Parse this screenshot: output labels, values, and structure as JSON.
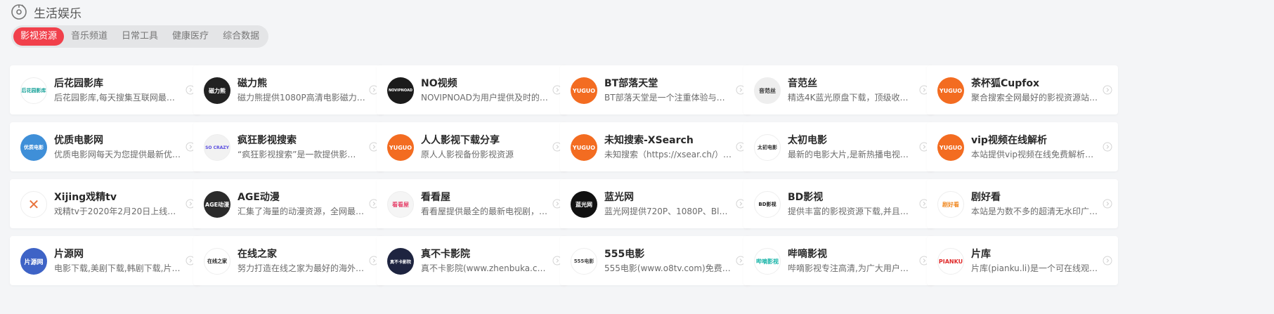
{
  "section": {
    "icon": "music-disc-icon",
    "title": "生活娱乐"
  },
  "tabs": [
    {
      "label": "影视资源",
      "active": true
    },
    {
      "label": "音乐频道",
      "active": false
    },
    {
      "label": "日常工具",
      "active": false
    },
    {
      "label": "健康医疗",
      "active": false
    },
    {
      "label": "综合数据",
      "active": false
    }
  ],
  "colors": {
    "accent": "#f1404b",
    "yuguo_orange": "#f36c21"
  },
  "cards": [
    {
      "title": "后花园影库",
      "desc": "后花园影库,每天搜集互联网最新…",
      "logo": {
        "text": "后花园影库",
        "bg": "#ffffff",
        "fg": "#1aa39a",
        "size": 7
      }
    },
    {
      "title": "磁力熊",
      "desc": "磁力熊提供1080P高清电影磁力…",
      "logo": {
        "text": "磁力熊",
        "bg": "#222222",
        "fg": "#ffffff",
        "size": 8
      }
    },
    {
      "title": "NO视频",
      "desc": "NOVIPNOAD为用户提供及时的…",
      "logo": {
        "text": "NOVIPNOAD",
        "bg": "#1b1b1b",
        "fg": "#ffffff",
        "size": 5
      }
    },
    {
      "title": "BT部落天堂",
      "desc": "BT部落天堂是一个注重体验与质…",
      "logo": {
        "text": "YUGUO",
        "bg": "#f36c21",
        "fg": "#ffffff",
        "size": 8
      }
    },
    {
      "title": "音范丝",
      "desc": "精选4K蓝光原盘下载，顶级收藏…",
      "logo": {
        "text": "音范丝",
        "bg": "#eeeeee",
        "fg": "#333333",
        "size": 8
      }
    },
    {
      "title": "茶杯狐Cupfox",
      "desc": "聚合搜索全网最好的影视资源站…",
      "logo": {
        "text": "YUGUO",
        "bg": "#f36c21",
        "fg": "#ffffff",
        "size": 8
      }
    },
    {
      "title": "优质电影网",
      "desc": "优质电影网每天为您提供最新优…",
      "logo": {
        "text": "优质电影",
        "bg": "#3f8fd8",
        "fg": "#ffffff",
        "size": 7
      }
    },
    {
      "title": "疯狂影视搜索",
      "desc": "“疯狂影视搜索”是一款提供影…",
      "logo": {
        "text": "SO CRAZY",
        "bg": "#f2f2f2",
        "fg": "#5a4de0",
        "size": 6
      }
    },
    {
      "title": "人人影视下载分享",
      "desc": "原人人影视备份影视资源",
      "logo": {
        "text": "YUGUO",
        "bg": "#f36c21",
        "fg": "#ffffff",
        "size": 8
      }
    },
    {
      "title": "未知搜索-XSearch",
      "desc": "未知搜索（https://xsear.ch/）聚…",
      "logo": {
        "text": "YUGUO",
        "bg": "#f36c21",
        "fg": "#ffffff",
        "size": 8
      }
    },
    {
      "title": "太初电影",
      "desc": "最新的电影大片,是新热播电视剧,…",
      "logo": {
        "text": "太初电影",
        "bg": "#ffffff",
        "fg": "#333333",
        "size": 7
      }
    },
    {
      "title": "vip视频在线解析",
      "desc": "本站提供vip视频在线免费解析，…",
      "logo": {
        "text": "YUGUO",
        "bg": "#f36c21",
        "fg": "#ffffff",
        "size": 8
      }
    },
    {
      "title": "Xijing戏精tv",
      "desc": "戏精tv于2020年2月20日上线，…",
      "logo": {
        "text": "✕",
        "bg": "#ffffff",
        "fg": "#e8733c",
        "size": 20
      }
    },
    {
      "title": "AGE动漫",
      "desc": "汇集了海量的动漫资源，全网最…",
      "logo": {
        "text": "AGE动漫",
        "bg": "#2b2b2b",
        "fg": "#ffffff",
        "size": 8
      }
    },
    {
      "title": "看看屋",
      "desc": "看看屋提供最全的最新电视剧，2…",
      "logo": {
        "text": "看看屋",
        "bg": "#f5f5f5",
        "fg": "#e6466e",
        "size": 8
      }
    },
    {
      "title": "蓝光网",
      "desc": "蓝光网提供720P、1080P、BluR…",
      "logo": {
        "text": "蓝光网",
        "bg": "#111111",
        "fg": "#ffffff",
        "size": 8
      }
    },
    {
      "title": "BD影视",
      "desc": "提供丰富的影视资源下载,并且可…",
      "logo": {
        "text": "BD影视",
        "bg": "#ffffff",
        "fg": "#222222",
        "size": 7
      }
    },
    {
      "title": "剧好看",
      "desc": "本站是为数不多的超清无水印广…",
      "logo": {
        "text": "剧好看",
        "bg": "#ffffff",
        "fg": "#f08a24",
        "size": 8
      }
    },
    {
      "title": "片源网",
      "desc": "电影下载,美剧下载,韩剧下载,片源…",
      "logo": {
        "text": "片源网",
        "bg": "#3e63c6",
        "fg": "#ffffff",
        "size": 9
      }
    },
    {
      "title": "在线之家",
      "desc": "努力打造在线之家为最好的海外…",
      "logo": {
        "text": "在线之家",
        "bg": "#ffffff",
        "fg": "#222222",
        "size": 7
      }
    },
    {
      "title": "真不卡影院",
      "desc": "真不卡影院(www.zhenbuka.com…",
      "logo": {
        "text": "真不卡影院",
        "bg": "#1e2440",
        "fg": "#ffffff",
        "size": 6
      }
    },
    {
      "title": "555电影",
      "desc": "555电影(www.o8tv.com)免费为…",
      "logo": {
        "text": "555电影",
        "bg": "#ffffff",
        "fg": "#444444",
        "size": 7
      }
    },
    {
      "title": "哔嘀影视",
      "desc": "哔嘀影视专注高清,为广大用户提…",
      "logo": {
        "text": "哔嘀影视",
        "bg": "#ffffff",
        "fg": "#19b4a8",
        "size": 8
      }
    },
    {
      "title": "片库",
      "desc": "片库(pianku.li)是一个可在线观看…",
      "logo": {
        "text": "PIANKU",
        "bg": "#ffffff",
        "fg": "#e02a2a",
        "size": 8
      }
    }
  ]
}
